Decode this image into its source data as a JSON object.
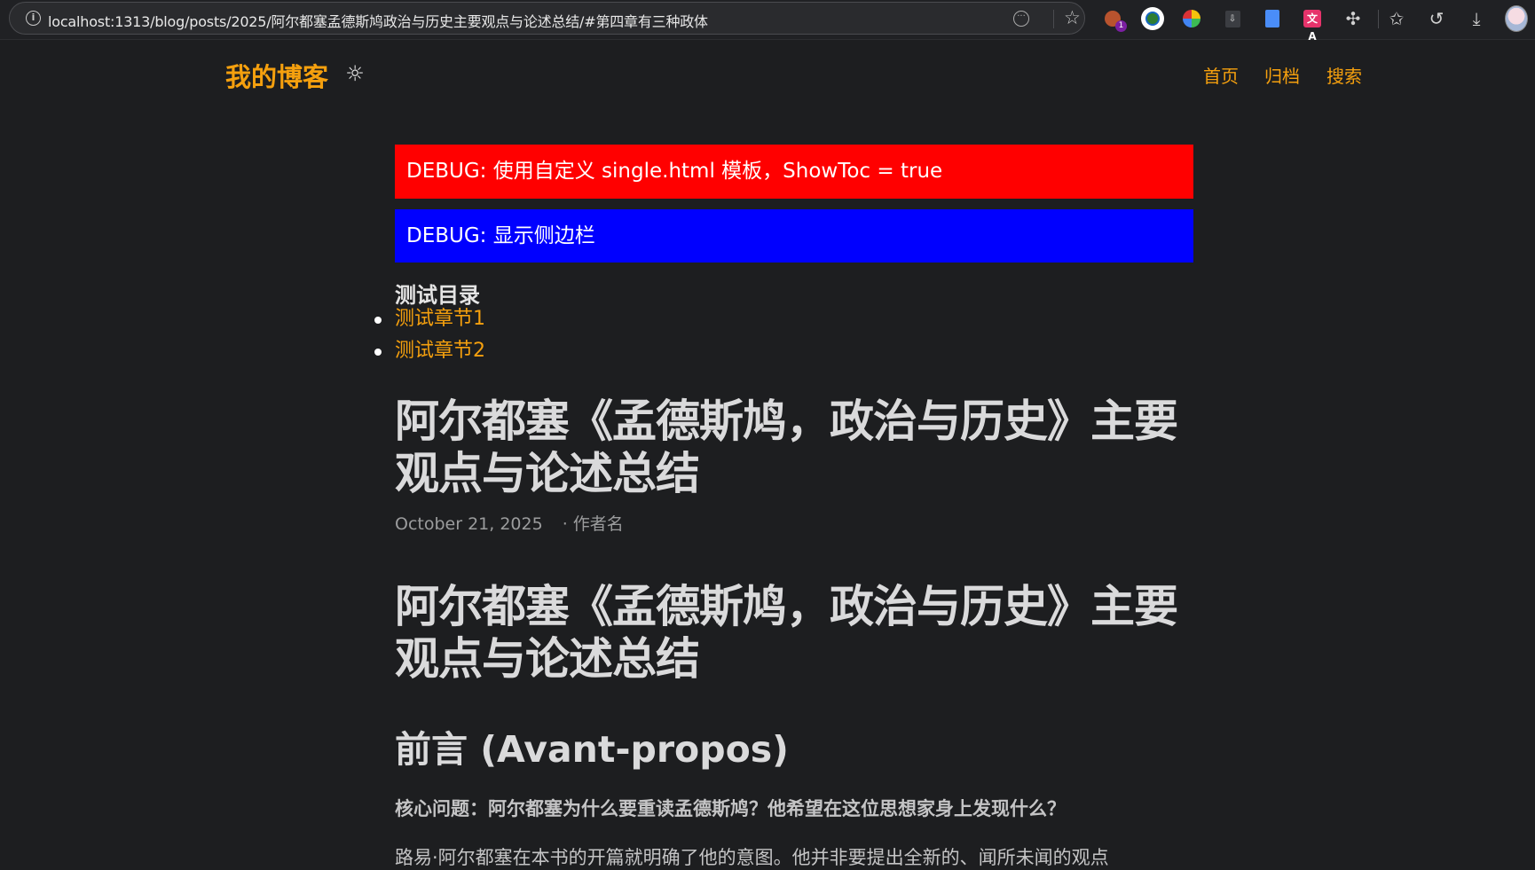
{
  "browser": {
    "url": "localhost:1313/blog/posts/2025/阿尔都塞孟德斯鸠政治与历史主要观点与论述总结/#第四章有三种政体",
    "extension_badge": "1",
    "translate_icon_text": "文A",
    "download_ext_text": "⇩",
    "icons": [
      "info-icon",
      "reader-mode-icon",
      "favorite-star-icon",
      "extension-ninja-icon",
      "extension-globe-icon",
      "extension-ball-icon",
      "extension-download-icon",
      "extension-doc-icon",
      "extension-translate-icon",
      "extensions-puzzle-icon",
      "favorites-icon",
      "history-icon",
      "downloads-icon",
      "profile-avatar-icon"
    ]
  },
  "site": {
    "title": "我的博客",
    "theme_toggle": "☼",
    "nav": {
      "home": "首页",
      "archive": "归档",
      "search": "搜索"
    }
  },
  "debug": {
    "template": "DEBUG: 使用自定义 single.html 模板，ShowToc = true",
    "sidebar": "DEBUG: 显示侧边栏"
  },
  "toc": {
    "title": "测试目录",
    "items": [
      "测试章节1",
      "测试章节2"
    ]
  },
  "post": {
    "title": "阿尔都塞《孟德斯鸠，政治与历史》主要观点与论述总结",
    "date": "October 21, 2025",
    "author": "· 作者名",
    "content_title": "阿尔都塞《孟德斯鸠，政治与历史》主要观点与论述总结",
    "h2": "前言 (Avant-propos)",
    "question": "核心问题：阿尔都塞为什么要重读孟德斯鸠？他希望在这位思想家身上发现什么？",
    "paragraph_start": "路易·阿尔都塞在本书的开篇就明确了他的意图。他并非要提出全新的、闻所未闻的观点"
  },
  "colors": {
    "accent": "#f5a00e",
    "background": "#1d1e20",
    "debug_red": "#ff0000",
    "debug_blue": "#0000ff"
  }
}
